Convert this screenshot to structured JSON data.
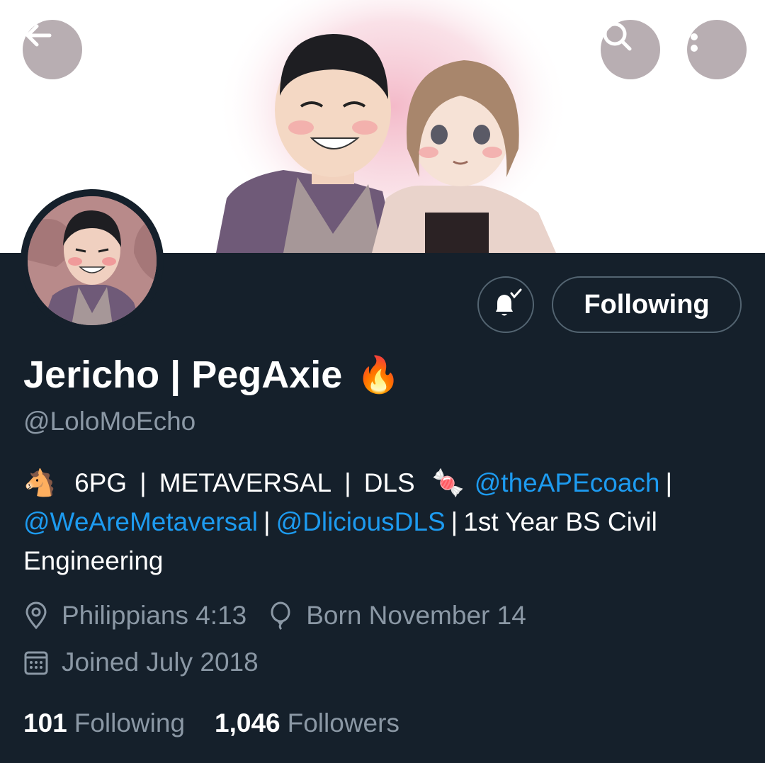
{
  "banner": {
    "back_icon": "arrow-left-icon",
    "search_icon": "search-icon",
    "more_icon": "more-vertical-icon"
  },
  "profile": {
    "display_name": "Jericho | PegAxie",
    "name_emoji": "🔥",
    "handle": "@LoloMoEcho",
    "notify_icon": "bell-check-icon",
    "follow_button_label": "Following"
  },
  "bio": {
    "line1_emoji": "🐴",
    "line1_text_1": "6PG",
    "line1_sep_1": "|",
    "line1_text_2": "METAVERSAL",
    "line1_sep_2": "|",
    "line1_text_3": "DLS",
    "line1_emoji_2": "🍬",
    "mention_1": "@theAPEcoach",
    "line1_sep_3": "|",
    "mention_2": "@WeAreMetaversal",
    "line2_sep_1": "|",
    "mention_3": "@DliciousDLS",
    "line2_sep_2": "|",
    "line2_text": "1st Year BS Civil",
    "line3_text": "Engineering"
  },
  "meta": {
    "location_icon": "location-pin-icon",
    "location": "Philippians 4:13",
    "birthday_icon": "balloon-icon",
    "birthday": "Born November 14",
    "joined_icon": "calendar-icon",
    "joined": "Joined July 2018"
  },
  "stats": {
    "following_count": "101",
    "following_label": "Following",
    "followers_count": "1,046",
    "followers_label": "Followers"
  },
  "colors": {
    "background": "#15202b",
    "accent_link": "#1d9bf0",
    "secondary_text": "#8b98a5",
    "border": "#536471"
  }
}
